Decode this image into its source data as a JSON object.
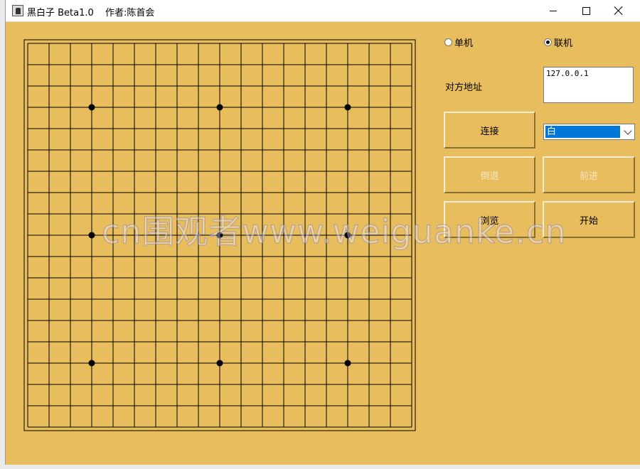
{
  "window": {
    "title": "黑白子 Beta1.0",
    "author": "作者:陈首会"
  },
  "board": {
    "lines": 19,
    "star_points": [
      [
        3,
        3
      ],
      [
        3,
        9
      ],
      [
        3,
        15
      ],
      [
        9,
        3
      ],
      [
        9,
        9
      ],
      [
        9,
        15
      ],
      [
        15,
        3
      ],
      [
        15,
        9
      ],
      [
        15,
        15
      ]
    ]
  },
  "mode": {
    "single_label": "单机",
    "online_label": "联机",
    "selected": "online"
  },
  "address": {
    "label": "对方地址",
    "value": "127.0.0.1"
  },
  "buttons": {
    "connect": "连接",
    "undo": "倒退",
    "forward": "前进",
    "browse": "浏览",
    "start": "开始"
  },
  "color_select": {
    "value": "白"
  },
  "watermark": "cn围观者www.weiguanke.cn",
  "colors": {
    "background": "#e8bd5d",
    "accent": "#0078d7"
  }
}
